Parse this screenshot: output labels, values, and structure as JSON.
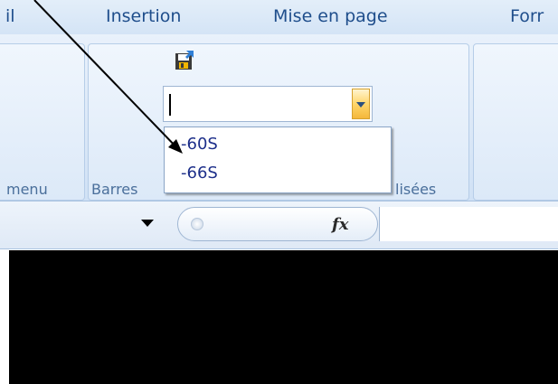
{
  "tabs": [
    "il",
    "Insertion",
    "Mise en page",
    "Forr"
  ],
  "groups": {
    "left_label": "menu",
    "middle_label_left": "Barres",
    "middle_label_right": "lisées"
  },
  "toolbar_combo": {
    "value": "",
    "icon": "save-icon"
  },
  "dropdown": {
    "items": [
      "-60S",
      "-66S"
    ]
  },
  "formula_bar": {
    "fx_label": "fx"
  },
  "colors": {
    "ribbon_text": "#1f4e8c",
    "dropdown_text": "#1d2f8a",
    "combo_button": "#ffd66a"
  }
}
